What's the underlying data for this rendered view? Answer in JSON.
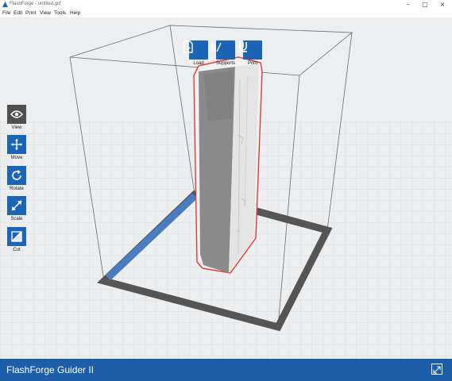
{
  "window": {
    "title": "FlashForge - untitled.gcf",
    "minimize_icon": "minimize-icon",
    "maximize_icon": "maximize-icon",
    "close_icon": "close-icon"
  },
  "menu": [
    "File",
    "Edit",
    "Print",
    "View",
    "Tools",
    "Help"
  ],
  "top_actions": [
    {
      "label": "Load",
      "icon": "load-file-icon"
    },
    {
      "label": "Supports",
      "icon": "supports-icon"
    },
    {
      "label": "Print",
      "icon": "print-icon"
    }
  ],
  "tools": [
    {
      "label": "View",
      "icon": "eye-icon",
      "active": true
    },
    {
      "label": "Move",
      "icon": "move-icon"
    },
    {
      "label": "Rotate",
      "icon": "rotate-icon"
    },
    {
      "label": "Scale",
      "icon": "scale-icon"
    },
    {
      "label": "Cut",
      "icon": "cut-icon"
    }
  ],
  "status": {
    "printer_name": "FlashForge Guider II"
  },
  "colors": {
    "accent": "#1b64b6",
    "status_bar": "#1d5ea8",
    "model_outline": "#e53935",
    "build_plate_border": "#555555",
    "active_tool": "#4f4f4f"
  }
}
